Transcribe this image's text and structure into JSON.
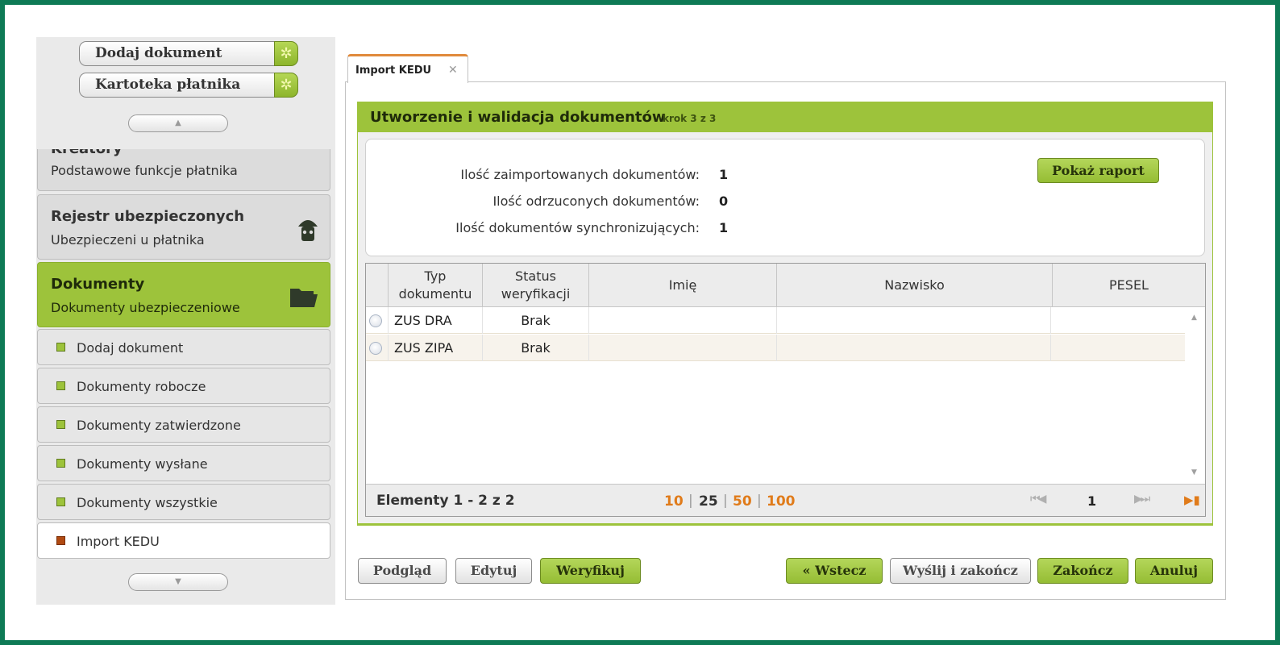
{
  "sidebar": {
    "quick_buttons": [
      {
        "label": "Dodaj dokument",
        "icon": "sparkle-icon"
      },
      {
        "label": "Kartoteka płatnika",
        "icon": "sparkle-icon"
      }
    ],
    "scroll_up_icon": "▲",
    "scroll_down_icon": "▼",
    "cards": [
      {
        "title": "Kreatory",
        "subtitle": "Podstawowe funkcje płatnika"
      },
      {
        "title": "Rejestr ubezpieczonych",
        "subtitle": "Ubezpieczeni u płatnika",
        "icon": "umbrella-person-icon"
      },
      {
        "title": "Dokumenty",
        "subtitle": "Dokumenty ubezpieczeniowe",
        "icon": "folder-icon",
        "active": true
      }
    ],
    "sub_items": [
      {
        "label": "Dodaj dokument"
      },
      {
        "label": "Dokumenty robocze"
      },
      {
        "label": "Dokumenty zatwierdzone"
      },
      {
        "label": "Dokumenty wysłane"
      },
      {
        "label": "Dokumenty wszystkie"
      },
      {
        "label": "Import KEDU",
        "current": true
      }
    ]
  },
  "tab": {
    "label": "Import KEDU",
    "close_icon": "✕"
  },
  "panel": {
    "title": "Utworzenie i walidacja dokumentów",
    "step": "krok 3 z 3",
    "summary": [
      {
        "label": "Ilość zaimportowanych dokumentów:",
        "value": "1"
      },
      {
        "label": "Ilość odrzuconych dokumentów:",
        "value": "0"
      },
      {
        "label": "Ilość dokumentów synchronizujących:",
        "value": "1"
      }
    ],
    "report_button": "Pokaż raport"
  },
  "grid": {
    "columns": [
      {
        "label": "Typ dokumentu",
        "line1": "Typ",
        "line2": "dokumentu"
      },
      {
        "label": "Status weryfikacji",
        "line1": "Status",
        "line2": "weryfikacji"
      },
      {
        "label": "Imię"
      },
      {
        "label": "Nazwisko"
      },
      {
        "label": "PESEL"
      }
    ],
    "rows": [
      {
        "typ": "ZUS DRA",
        "status": "Brak",
        "imie": "",
        "nazwisko": "",
        "pesel": ""
      },
      {
        "typ": "ZUS ZIPA",
        "status": "Brak",
        "imie": "",
        "nazwisko": "",
        "pesel": ""
      }
    ],
    "footer": {
      "range": "Elementy 1 - 2 z 2",
      "page_sizes": [
        "10",
        "25",
        "50",
        "100"
      ],
      "selected_page_size": "25",
      "page_sep": "|",
      "current_page": "1",
      "first_prev_icon": "⏮◀",
      "next_last_icon": "▶⏭",
      "export_icon": "▶▮"
    }
  },
  "actions": {
    "left": [
      "Podgląd",
      "Edytuj",
      "Weryfikuj"
    ],
    "right": [
      "« Wstecz",
      "Wyślij i zakończ",
      "Zakończ",
      "Anuluj"
    ]
  },
  "colors": {
    "accent_green": "#9dc33b",
    "frame_green": "#0e7a55",
    "accent_orange": "#e07b1a",
    "tab_orange": "#e08a3c"
  }
}
